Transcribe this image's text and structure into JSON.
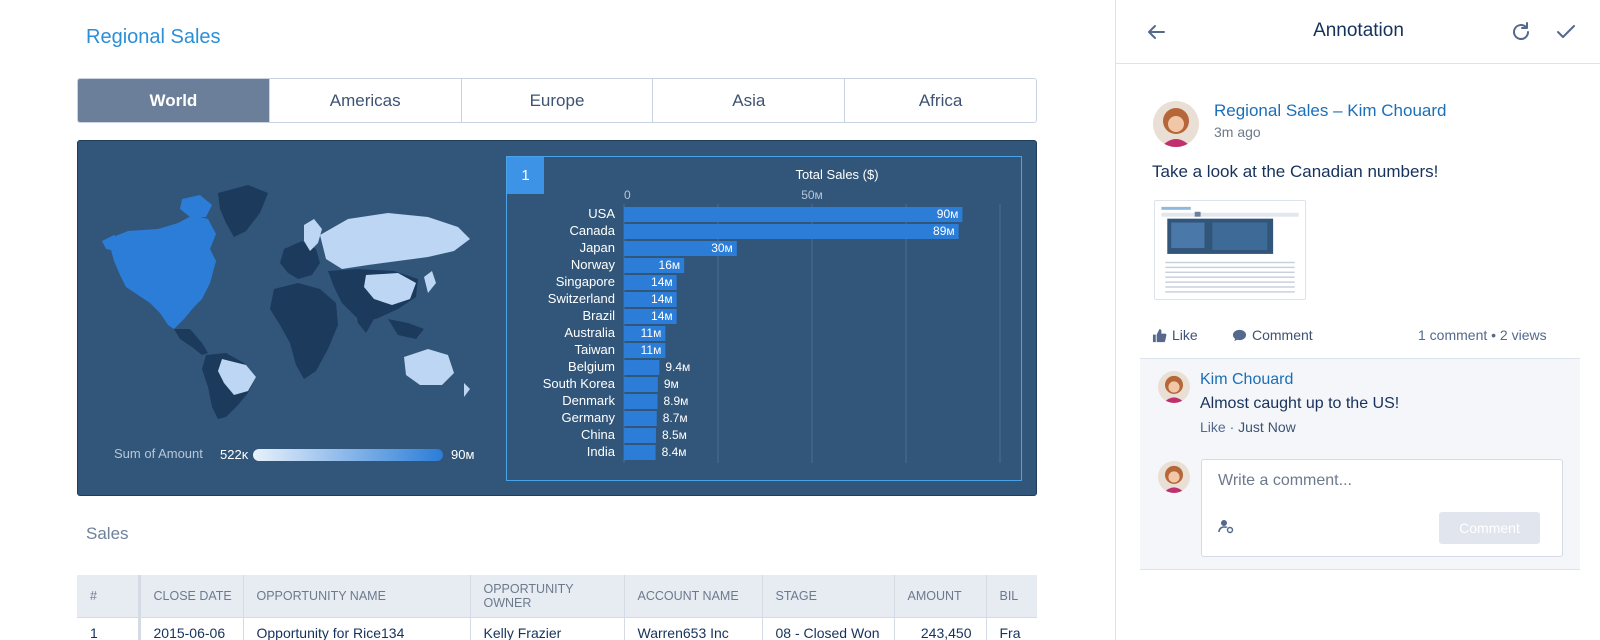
{
  "dashboard": {
    "title": "Regional Sales",
    "tabs": [
      {
        "label": "World",
        "active": true
      },
      {
        "label": "Americas",
        "active": false
      },
      {
        "label": "Europe",
        "active": false
      },
      {
        "label": "Asia",
        "active": false
      },
      {
        "label": "Africa",
        "active": false
      }
    ],
    "legend": {
      "title": "Sum of Amount",
      "min": "522ĸ",
      "max": "90м"
    },
    "step_badge": "1",
    "section_title": "Sales",
    "table": {
      "columns": [
        "#",
        "CLOSE DATE",
        "OPPORTUNITY NAME",
        "OPPORTUNITY OWNER",
        "ACCOUNT NAME",
        "STAGE",
        "AMOUNT",
        "BIL"
      ],
      "rows": [
        [
          "1",
          "2015-06-06",
          "Opportunity for Rice134",
          "Kelly Frazier",
          "Warren653 Inc",
          "08 - Closed Won",
          "243,450",
          "Fra"
        ]
      ]
    }
  },
  "chart_data": {
    "type": "bar",
    "orientation": "horizontal",
    "title": "Total Sales ($)",
    "xlabel": "Total Sales ($)",
    "axis_ticks": [
      "0",
      "50м"
    ],
    "xlim": [
      0,
      100000000
    ],
    "categories": [
      "USA",
      "Canada",
      "Japan",
      "Norway",
      "Singapore",
      "Switzerland",
      "Brazil",
      "Australia",
      "Taiwan",
      "Belgium",
      "South Korea",
      "Denmark",
      "Germany",
      "China",
      "India"
    ],
    "values": [
      90000000,
      89000000,
      30000000,
      16000000,
      14000000,
      14000000,
      14000000,
      11000000,
      11000000,
      9400000,
      9000000,
      8900000,
      8700000,
      8500000,
      8400000
    ],
    "value_labels": [
      "90м",
      "89м",
      "30м",
      "16м",
      "14м",
      "14м",
      "14м",
      "11м",
      "11м",
      "9.4м",
      "9м",
      "8.9м",
      "8.7м",
      "8.5м",
      "8.4м"
    ],
    "bar_color": "#2b7dd8",
    "grid": true
  },
  "annotation": {
    "title": "Annotation",
    "post": {
      "author": "Regional Sales – Kim Chouard",
      "time": "3m ago",
      "body": "Take a look at the Canadian numbers!",
      "like_label": "Like",
      "comment_label": "Comment",
      "stats": "1 comment  •  2 views"
    },
    "comment": {
      "author": "Kim Chouard",
      "text": "Almost caught up to the US!",
      "like_label": "Like",
      "separator": "·",
      "time": "Just Now"
    },
    "composer": {
      "placeholder": "Write a comment...",
      "submit_label": "Comment"
    }
  },
  "colors": {
    "accent": "#2b8fd8",
    "panel_bg": "#32567a",
    "tab_active": "#6c7f9a",
    "bar": "#2b7dd8"
  }
}
